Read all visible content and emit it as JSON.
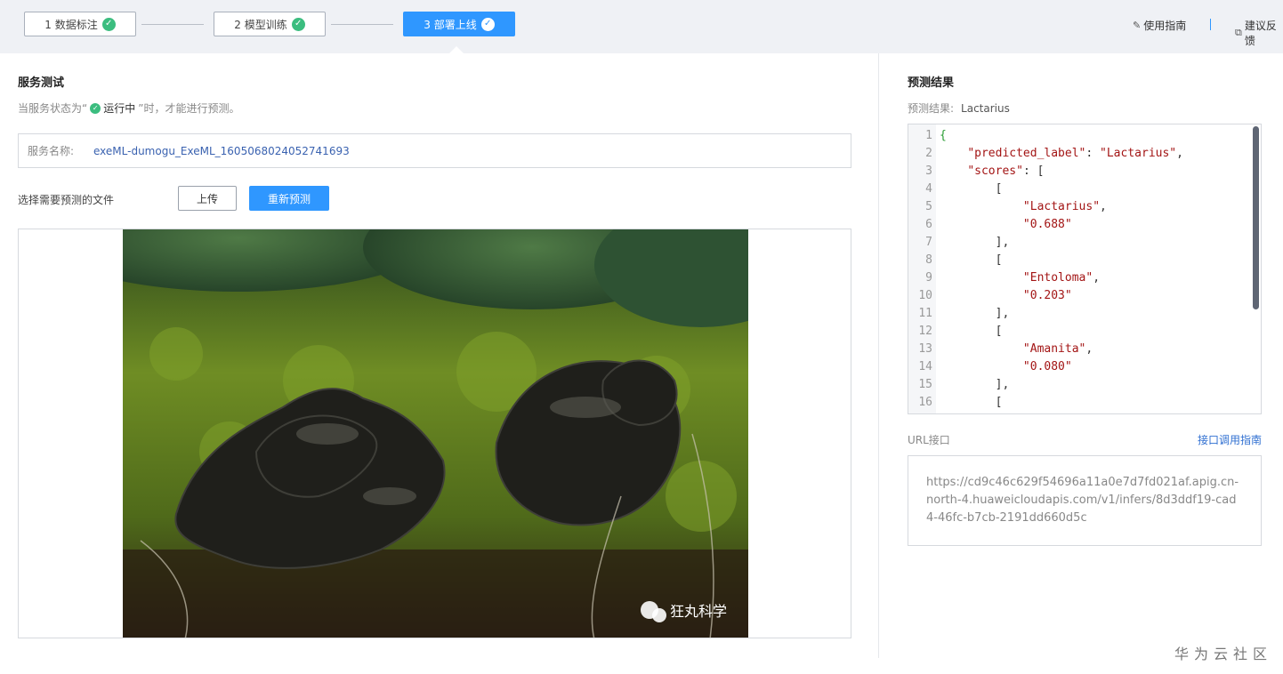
{
  "steps": [
    {
      "label": "1 数据标注",
      "state": "done"
    },
    {
      "label": "2 模型训练",
      "state": "done"
    },
    {
      "label": "3 部署上线",
      "state": "active"
    }
  ],
  "top_links": {
    "guide": "使用指南",
    "feedback": "建议反馈"
  },
  "service_test": {
    "title": "服务测试",
    "note_prefix": "当服务状态为“",
    "note_status": "运行中",
    "note_suffix": "”时，才能进行预测。",
    "name_label": "服务名称:",
    "name_value": "exeML-dumogu_ExeML_1605068024052741693",
    "file_label": "选择需要预测的文件",
    "upload_label": "上传",
    "repredict_label": "重新预测",
    "image_watermark": "狂丸科学"
  },
  "prediction": {
    "title": "预测结果",
    "result_label": "预测结果:",
    "result_value": "Lactarius",
    "code_lines": [
      "{",
      "    \"predicted_label\": \"Lactarius\",",
      "    \"scores\": [",
      "        [",
      "            \"Lactarius\",",
      "            \"0.688\"",
      "        ],",
      "        [",
      "            \"Entoloma\",",
      "            \"0.203\"",
      "        ],",
      "        [",
      "            \"Amanita\",",
      "            \"0.080\"",
      "        ],",
      "        ["
    ]
  },
  "url_section": {
    "label": "URL接口",
    "guide_link": "接口调用指南",
    "url": "https://cd9c46c629f54696a11a0e7d7fd021af.apig.cn-north-4.huaweicloudapis.com/v1/infers/8d3ddf19-cad4-46fc-b7cb-2191dd660d5c"
  },
  "footer_watermark": "华为云社区",
  "colors": {
    "primary": "#2f97ff",
    "success": "#3bbd7f",
    "link": "#2f6fd1"
  }
}
